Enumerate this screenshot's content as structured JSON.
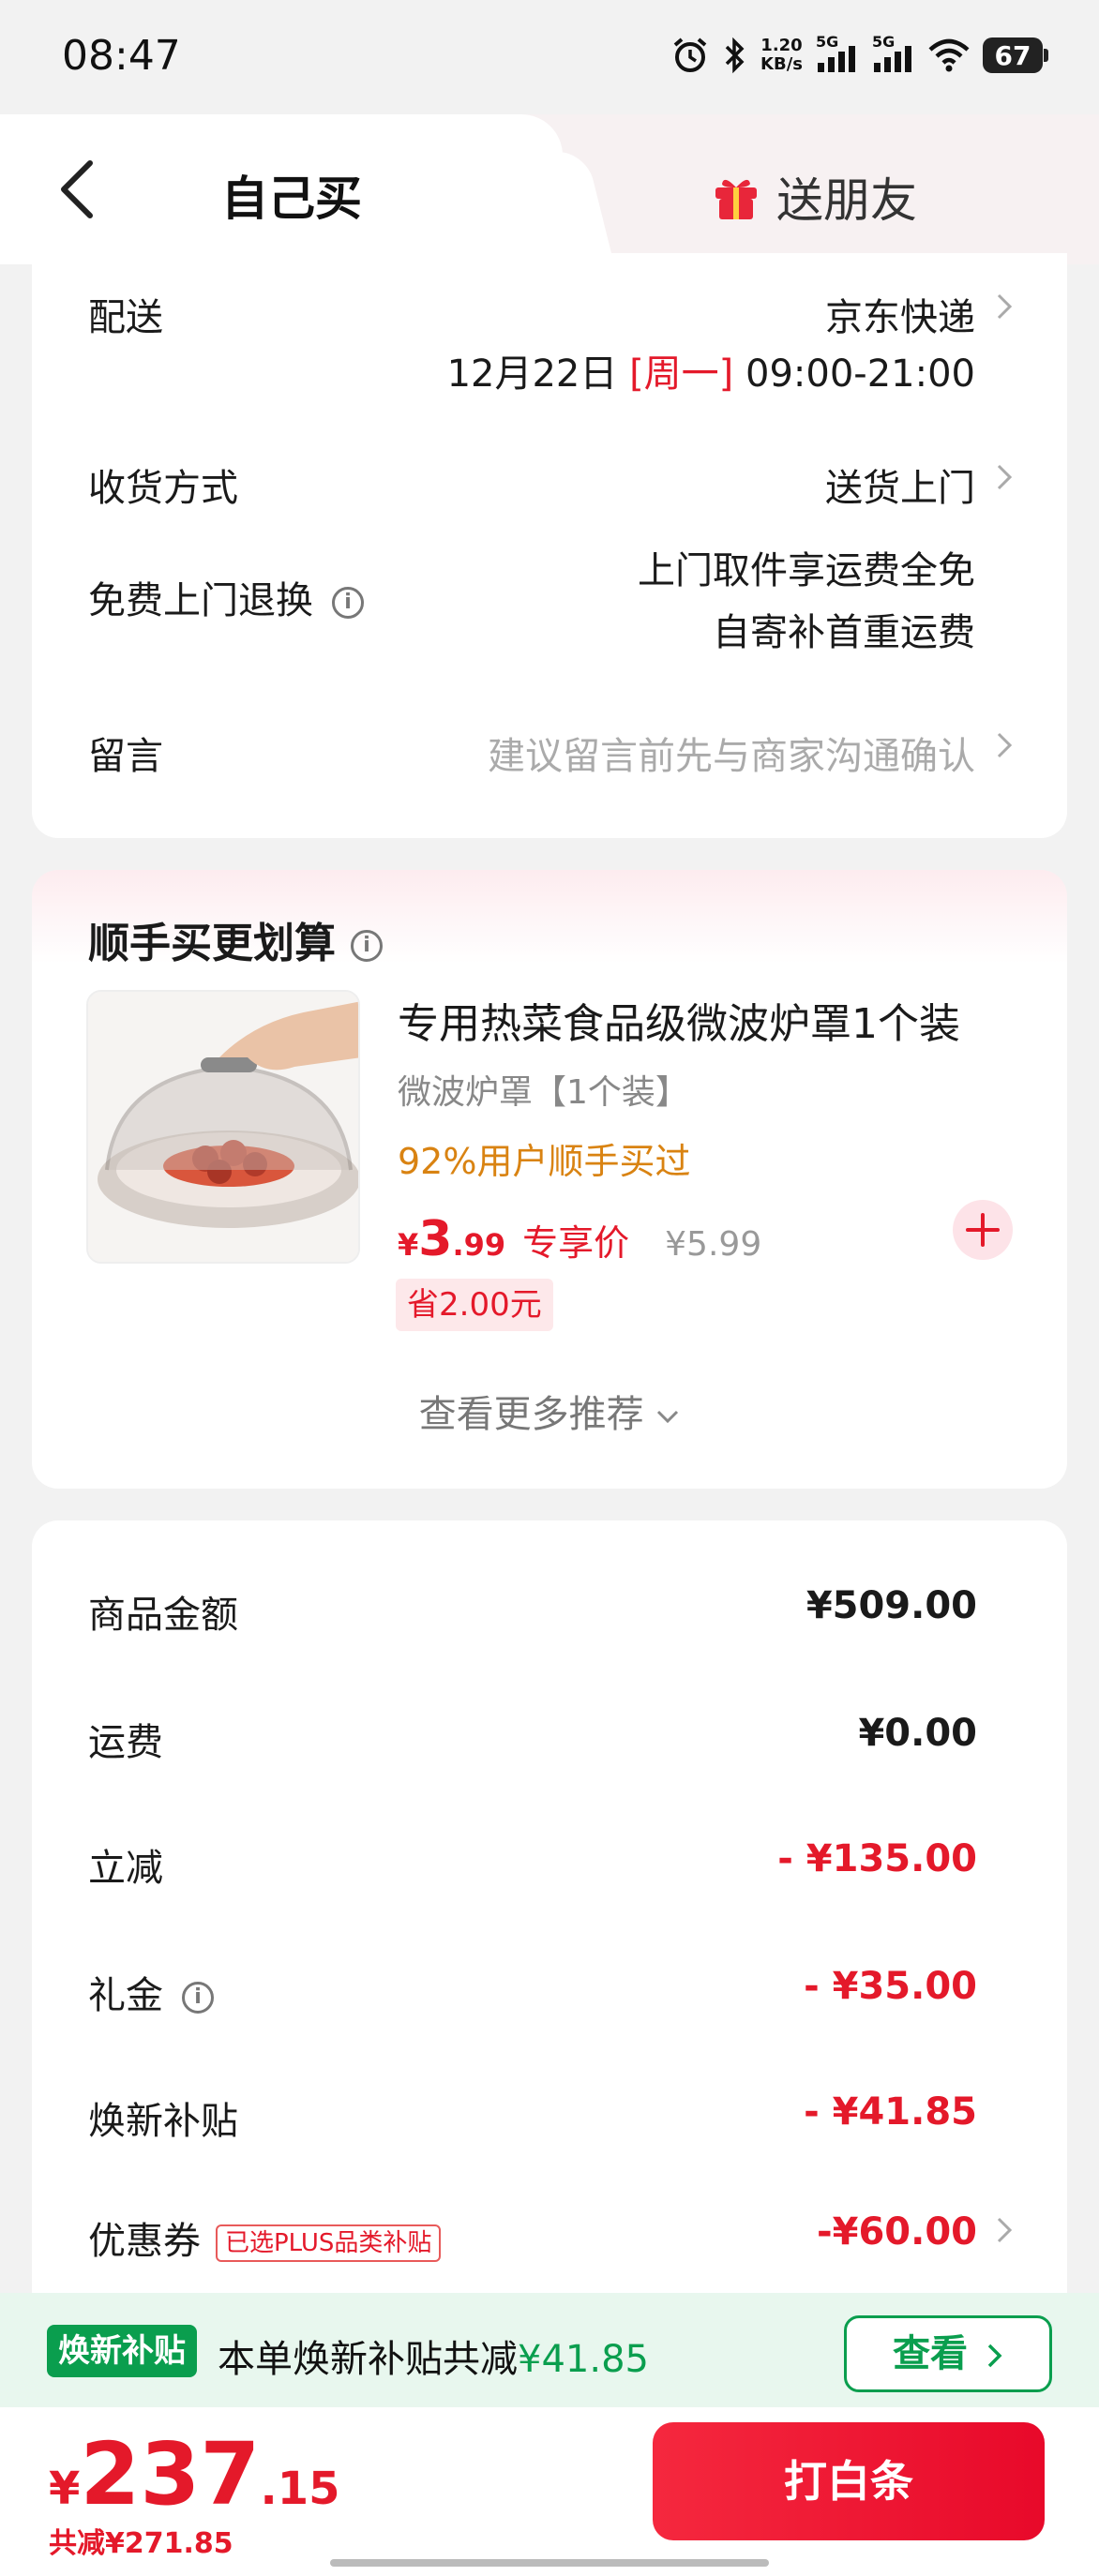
{
  "status_bar": {
    "time": "08:47",
    "net_speed_top": "1.20",
    "net_speed_bottom": "KB/s",
    "sim1": "5G",
    "sim2": "5G",
    "battery": "67"
  },
  "tabs": {
    "self": "自己买",
    "friend": "送朋友"
  },
  "delivery": {
    "label": "配送",
    "carrier": "京东快递",
    "date": "12月22日",
    "weekday": "[周一]",
    "time_range": "09:00-21:00",
    "receive_label": "收货方式",
    "receive_value": "送货上门",
    "return_label": "免费上门退换",
    "return_line1": "上门取件享运费全免",
    "return_line2": "自寄补首重运费",
    "message_label": "留言",
    "message_placeholder": "建议留言前先与商家沟通确认"
  },
  "recommend": {
    "title": "顺手买更划算",
    "product_name": "专用热菜食品级微波炉罩1个装",
    "product_spec": "微波炉罩【1个装】",
    "popularity": "92%用户顺手买过",
    "price_yen": "¥",
    "price_int": "3",
    "price_dec": ".99",
    "price_tag": "专享价",
    "price_old": "¥5.99",
    "save": "省2.00元",
    "more": "查看更多推荐"
  },
  "summary": {
    "rows": [
      {
        "label": "商品金额",
        "value": "¥509.00",
        "type": "normal"
      },
      {
        "label": "运费",
        "value": "¥0.00",
        "type": "normal"
      },
      {
        "label": "立减",
        "value": "- ¥135.00",
        "type": "discount"
      },
      {
        "label": "礼金",
        "value": "- ¥35.00",
        "type": "discount"
      },
      {
        "label": "焕新补贴",
        "value": "- ¥41.85",
        "type": "discount"
      },
      {
        "label": "优惠券",
        "value": "-¥60.00",
        "type": "discount"
      }
    ],
    "coupon_badge": "已选PLUS品类补贴"
  },
  "banner": {
    "tag": "焕新补贴",
    "text": "本单焕新补贴共减",
    "amount": "¥41.85",
    "button": "查看"
  },
  "bottom": {
    "yen": "¥",
    "total_int": "237",
    "total_dec": ".15",
    "saved": "共减¥271.85",
    "pay_button": "打白条"
  },
  "colors": {
    "accent_red": "#e4192a",
    "subsidy_green": "#0a9e4e",
    "popularity_orange": "#d98312"
  }
}
